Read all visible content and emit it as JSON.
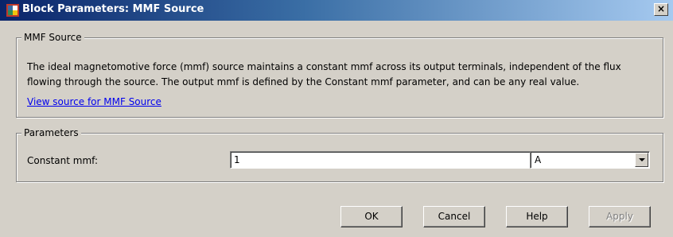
{
  "window": {
    "title": "Block Parameters: MMF Source",
    "close_label": "×",
    "title_gradient": [
      "#0a246a",
      "#a6caf0"
    ]
  },
  "block_group": {
    "legend": "MMF Source",
    "description": "The ideal magnetomotive force (mmf) source maintains a constant mmf across its output terminals, independent of the flux flowing through the source. The output mmf is defined by the Constant mmf parameter, and can be any real value.",
    "link_text": "View source for MMF Source"
  },
  "parameters_group": {
    "legend": "Parameters",
    "constant_mmf": {
      "label": "Constant mmf:",
      "value": "1",
      "unit": "A"
    }
  },
  "buttons": {
    "ok": "OK",
    "cancel": "Cancel",
    "help": "Help",
    "apply": "Apply"
  },
  "icons": {
    "app": "simulink-block-icon",
    "close": "close-icon",
    "dropdown": "chevron-down-icon"
  }
}
